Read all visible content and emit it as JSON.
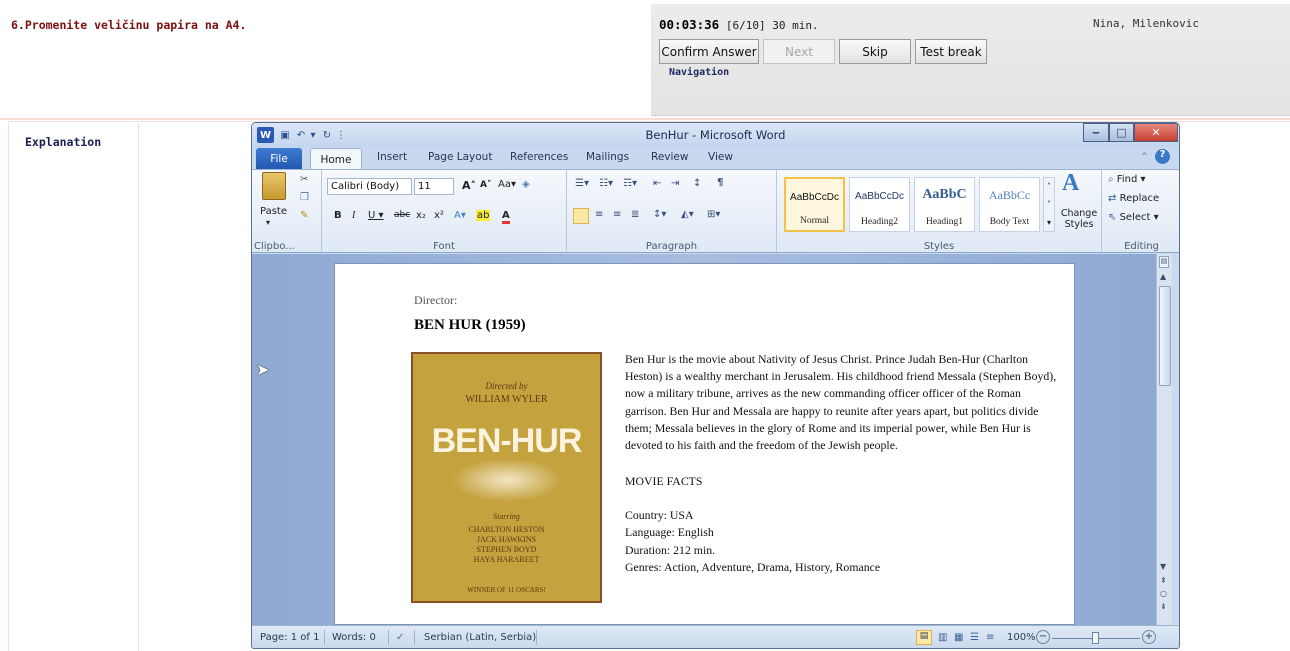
{
  "question": "6.Promenite veličinu papira na A4.",
  "nav": {
    "timer": "00:03:36",
    "progress": "[6/10] 30 min.",
    "user": "Nina, Milenkovic",
    "buttons": {
      "confirm": "Confirm Answer",
      "next": "Next",
      "skip": "Skip",
      "test_break": "Test break"
    },
    "label": "Navigation"
  },
  "explanation_label": "Explanation",
  "word": {
    "title": "BenHur - Microsoft Word",
    "tabs": {
      "file": "File",
      "home": "Home",
      "insert": "Insert",
      "page_layout": "Page Layout",
      "references": "References",
      "mailings": "Mailings",
      "review": "Review",
      "view": "View"
    },
    "clipboard": {
      "paste": "Paste",
      "label": "Clipbo..."
    },
    "font": {
      "name": "Calibri (Body)",
      "size": "11",
      "label": "Font"
    },
    "paragraph_label": "Paragraph",
    "styles": {
      "items": [
        {
          "preview": "AaBbCcDc",
          "name": "Normal"
        },
        {
          "preview": "AaBbCcDc",
          "name": "Heading2"
        },
        {
          "preview": "AaBbC",
          "name": "Heading1"
        },
        {
          "preview": "AaBbCc",
          "name": "Body Text"
        }
      ],
      "change_styles": "Change Styles",
      "label": "Styles"
    },
    "editing": {
      "find": "Find",
      "replace": "Replace",
      "select": "Select",
      "label": "Editing"
    },
    "document": {
      "director": "Director:",
      "title": "BEN HUR (1959)",
      "poster": {
        "directed_by": "Directed by",
        "director_name": "WILLIAM WYLER",
        "title": "BEN-HUR",
        "starring": "Starring",
        "cast": [
          "CHARLTON HESTON",
          "JACK HAWKINS",
          "STEPHEN BOYD",
          "HAYA HARAREET"
        ],
        "award": "WINNER OF 11 OSCARS!"
      },
      "summary": "Ben Hur is the movie about Nativity of Jesus Christ. Prince Judah Ben-Hur (Charlton Heston) is a wealthy merchant in Jerusalem. His childhood friend Messala (Stephen Boyd), now a military tribune, arrives as the new commanding officer officer of the Roman garrison. Ben Hur and Messala are happy to reunite after years apart, but politics divide them; Messala believes in the glory of Rome and its imperial power, while Ben Hur is devoted to his faith and the freedom of the Jewish people.",
      "facts_heading": "MOVIE FACTS",
      "facts": [
        "Country: USA",
        "Language: English",
        "Duration: 212 min.",
        "Genres: Action, Adventure, Drama, History, Romance"
      ]
    },
    "status": {
      "page": "Page: 1 of 1",
      "words": "Words: 0",
      "language": "Serbian (Latin, Serbia)",
      "zoom": "100%"
    }
  }
}
